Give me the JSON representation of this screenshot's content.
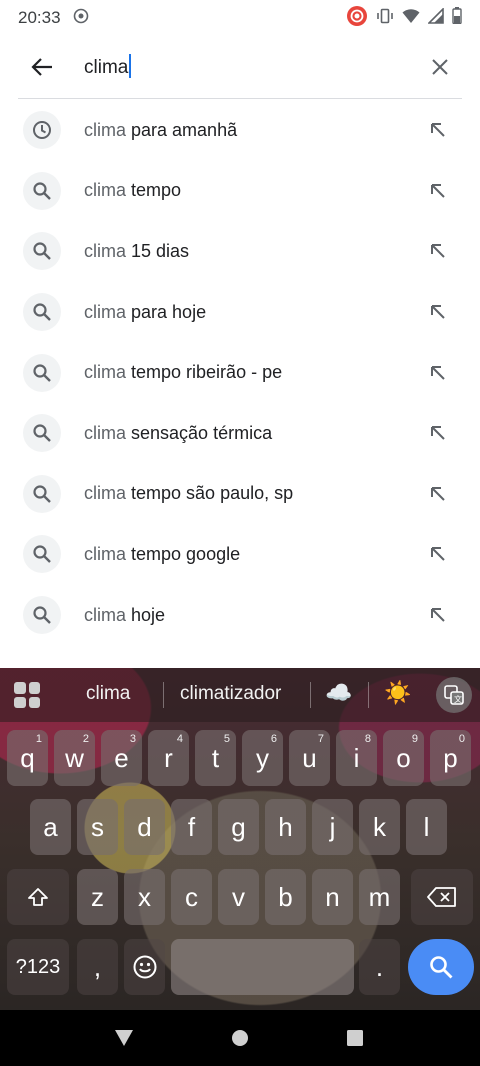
{
  "status_bar": {
    "time": "20:33"
  },
  "search": {
    "query": "clima"
  },
  "suggestions": [
    {
      "prefix": "clima",
      "rest": " para amanhã",
      "icon": "history-icon"
    },
    {
      "prefix": "clima",
      "rest": " tempo",
      "icon": "search-icon"
    },
    {
      "prefix": "clima",
      "rest": " 15 dias",
      "icon": "search-icon"
    },
    {
      "prefix": "clima",
      "rest": " para hoje",
      "icon": "search-icon"
    },
    {
      "prefix": "clima",
      "rest": " tempo ribeirão - pe",
      "icon": "search-icon"
    },
    {
      "prefix": "clima",
      "rest": " sensação térmica",
      "icon": "search-icon"
    },
    {
      "prefix": "clima",
      "rest": " tempo são paulo, sp",
      "icon": "search-icon"
    },
    {
      "prefix": "clima",
      "rest": " tempo google",
      "icon": "search-icon"
    },
    {
      "prefix": "clima",
      "rest": " hoje",
      "icon": "search-icon"
    }
  ],
  "keyboard": {
    "strip": {
      "word1": "clima",
      "word2": "climatizador",
      "emoji1": "☁️",
      "emoji2": "☀️"
    },
    "row1": [
      {
        "k": "q",
        "n": "1"
      },
      {
        "k": "w",
        "n": "2"
      },
      {
        "k": "e",
        "n": "3"
      },
      {
        "k": "r",
        "n": "4"
      },
      {
        "k": "t",
        "n": "5"
      },
      {
        "k": "y",
        "n": "6"
      },
      {
        "k": "u",
        "n": "7"
      },
      {
        "k": "i",
        "n": "8"
      },
      {
        "k": "o",
        "n": "9"
      },
      {
        "k": "p",
        "n": "0"
      }
    ],
    "row2": [
      "a",
      "s",
      "d",
      "f",
      "g",
      "h",
      "j",
      "k",
      "l"
    ],
    "row3": [
      "z",
      "x",
      "c",
      "v",
      "b",
      "n",
      "m"
    ],
    "symbols_label": "?123",
    "comma": ",",
    "period": "."
  },
  "colors": {
    "accent": "#1a73e8",
    "search_key": "#4a8cf5"
  }
}
